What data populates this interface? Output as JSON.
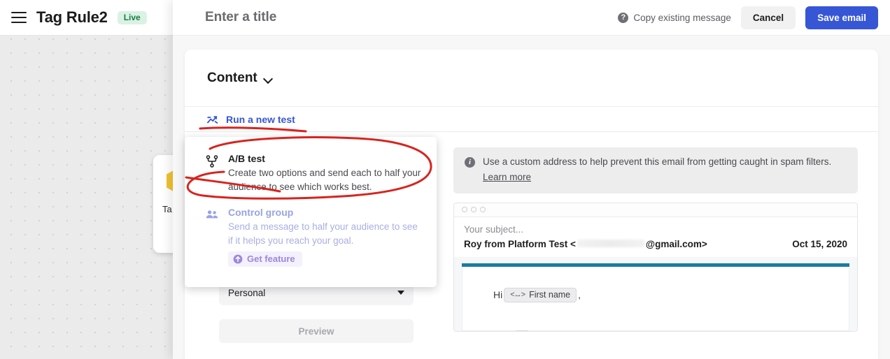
{
  "app_header": {
    "menu_icon": "hamburger-icon",
    "flow_title": "Tag Rule2",
    "status_badge": "Live"
  },
  "canvas": {
    "node_label": "Ta",
    "node_icon": "tag-hexagon-icon"
  },
  "modal": {
    "title_placeholder": "Enter a title",
    "copy_existing_label": "Copy existing message",
    "help_icon": "question-mark-icon",
    "cancel_label": "Cancel",
    "save_label": "Save email",
    "accent_color": "#3656d6"
  },
  "content": {
    "heading": "Content",
    "chevron_icon": "chevron-down-icon",
    "run_test_label": "Run a new test",
    "run_test_icon": "trend-shuffle-icon"
  },
  "test_menu": {
    "items": [
      {
        "icon": "split-branch-icon",
        "title": "A/B test",
        "description": "Create two options and send each to half your audience to see which works best.",
        "disabled": false
      },
      {
        "icon": "two-people-icon",
        "title": "Control group",
        "description": "Send a message to half your audience to see if it helps you reach your goal.",
        "disabled": true,
        "badge_label": "Get feature",
        "badge_icon": "upgrade-arrow-icon"
      }
    ]
  },
  "left_form": {
    "sender_select_value": "Personal",
    "caret_icon": "caret-down-icon",
    "preview_label": "Preview"
  },
  "spam_banner": {
    "info_icon": "info-icon",
    "text": "Use a custom address to help prevent this email from getting caught in spam filters.",
    "link_label": "Learn more"
  },
  "email_preview": {
    "window_dots": "browser-dots-icon",
    "subject_placeholder": "Your subject...",
    "sender_prefix": "Roy from Platform Test <",
    "sender_suffix": "@gmail.com>",
    "date": "Oct 15, 2020",
    "accent_color": "#1b7ca1",
    "greeting": "Hi",
    "merge_tag_icon": "code-brackets-icon",
    "merge_tag_label": "First name",
    "greeting_suffix": ","
  },
  "annotations": {
    "color": "#d7241f",
    "underline_target": "Run a new test",
    "circle_target": "A/B test"
  }
}
